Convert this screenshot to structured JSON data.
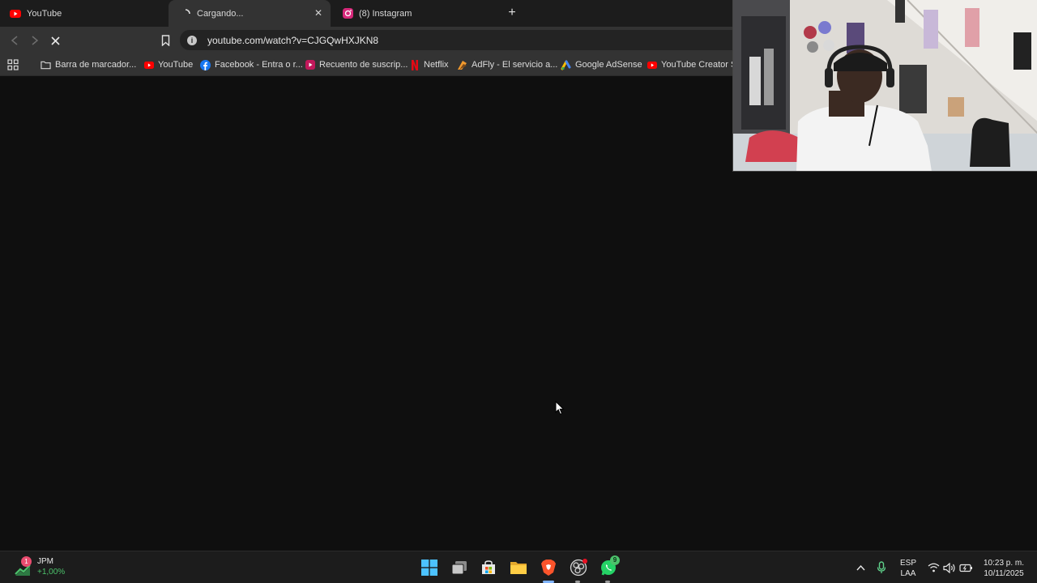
{
  "browser": {
    "tabs": [
      {
        "title": "YouTube",
        "favicon": "youtube-icon"
      },
      {
        "title": "Cargando...",
        "favicon": "loading-spinner-icon",
        "active": true
      },
      {
        "title": "(8) Instagram",
        "favicon": "instagram-icon"
      }
    ],
    "url": "youtube.com/watch?v=CJGQwHXJKN8",
    "bookmarks": [
      {
        "label": "Barra de marcador...",
        "icon": "folder-icon"
      },
      {
        "label": "YouTube",
        "icon": "youtube-icon"
      },
      {
        "label": "Facebook - Entra o r...",
        "icon": "facebook-icon"
      },
      {
        "label": "Recuento de suscrip...",
        "icon": "youtube-studio-icon"
      },
      {
        "label": "Netflix",
        "icon": "netflix-icon"
      },
      {
        "label": "AdFly - El servicio a...",
        "icon": "adfly-icon"
      },
      {
        "label": "Google AdSense",
        "icon": "adsense-icon"
      },
      {
        "label": "YouTube Creator St...",
        "icon": "youtube-icon"
      }
    ]
  },
  "taskbar": {
    "stock": {
      "symbol": "JPM",
      "change": "+1,00%",
      "badge": "1"
    },
    "whatsapp_badge": "9",
    "language": {
      "line1": "ESP",
      "line2": "LAA"
    },
    "clock": {
      "time": "10:23 p. m.",
      "date": "10/11/2025"
    }
  },
  "colors": {
    "accent_youtube": "#ff0000",
    "stock_up": "#4cc26b",
    "taskbar_bg": "#1c1c1c"
  }
}
